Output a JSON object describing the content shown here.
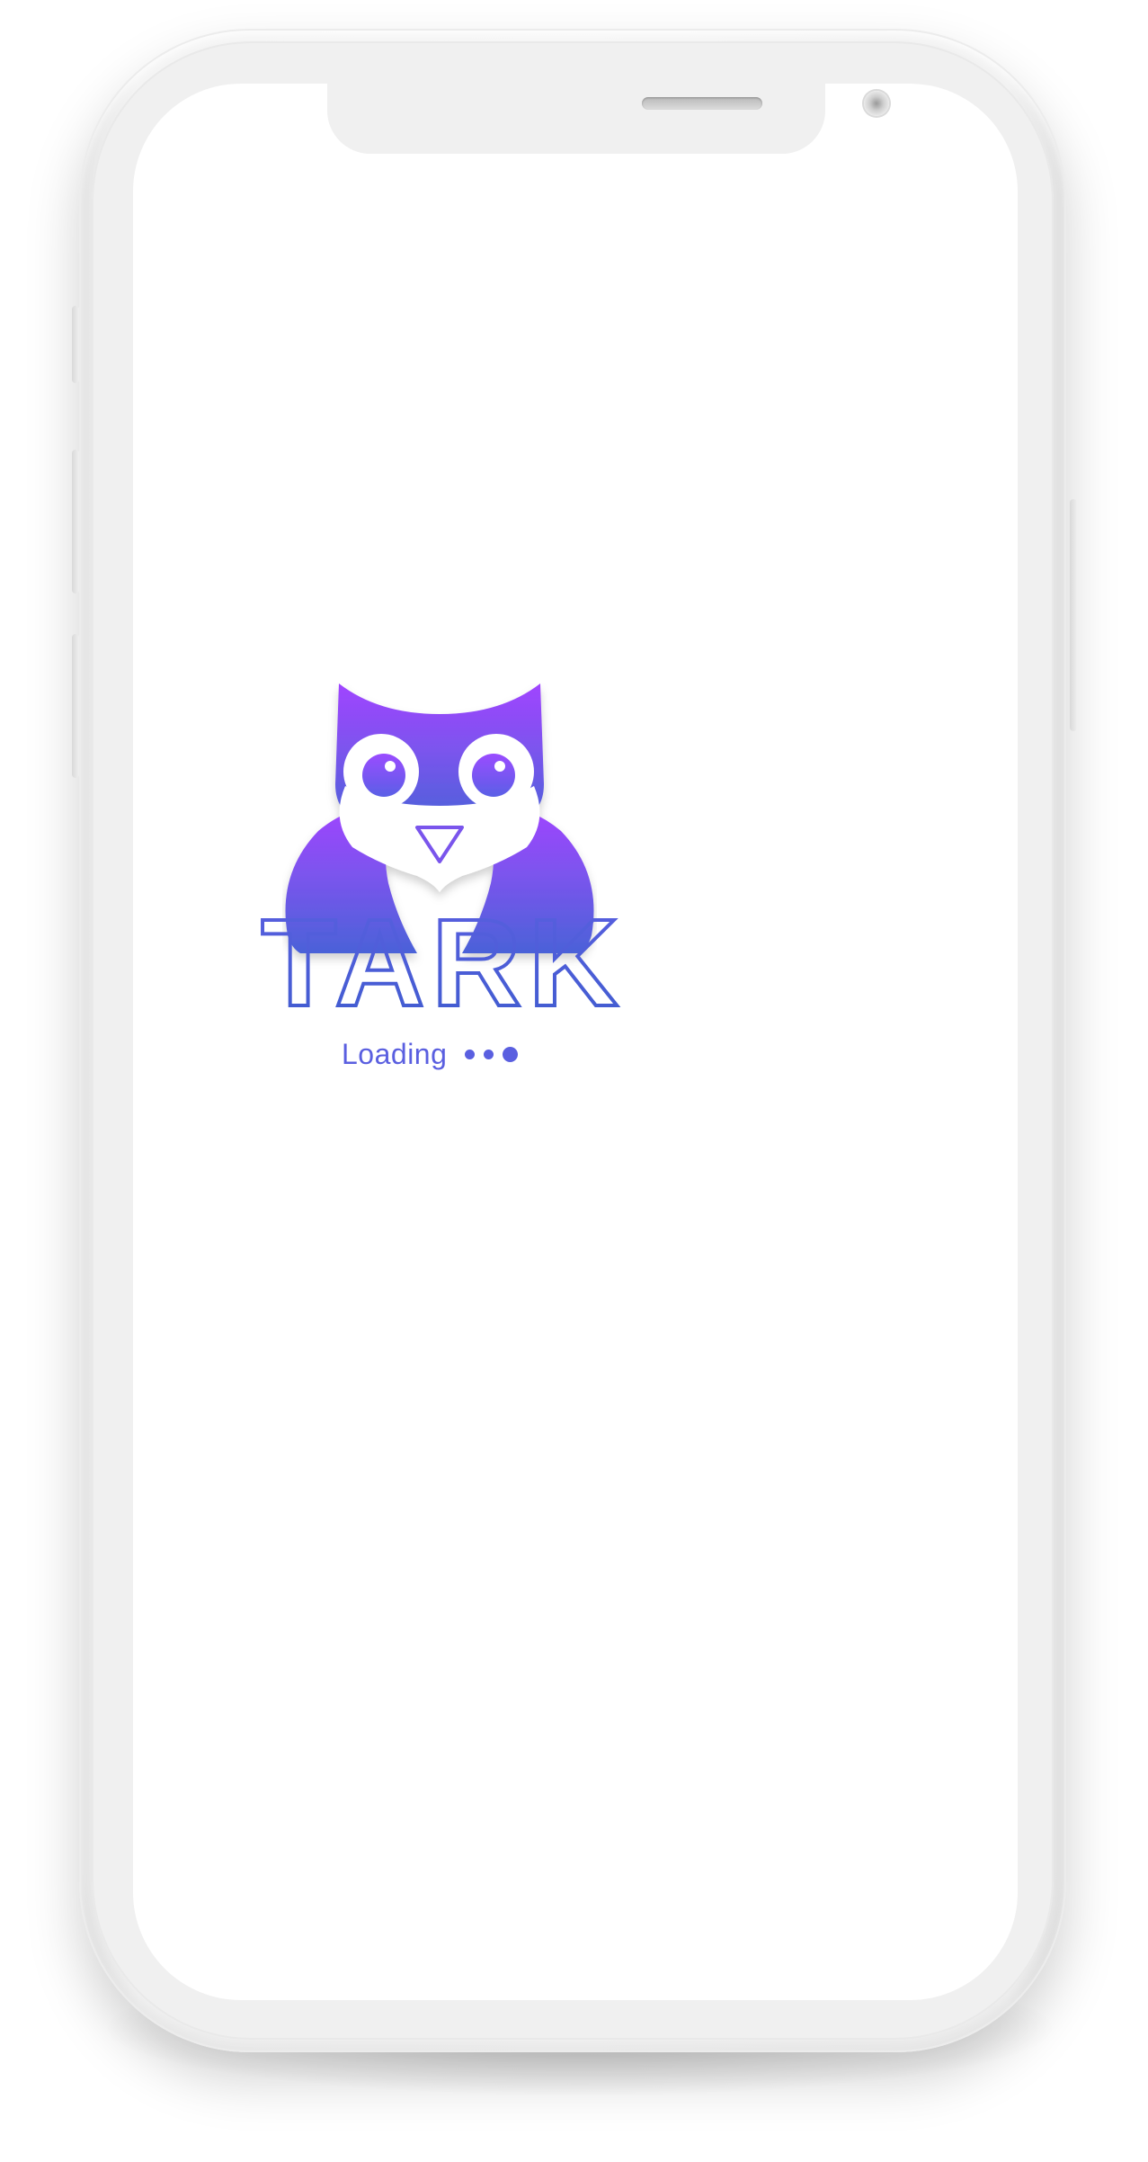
{
  "app": {
    "name": "TARK",
    "status_text": "Loading"
  },
  "colors": {
    "brand_purple": "#a044ff",
    "brand_blue": "#4a62d8",
    "loading_text": "#5a5fe0",
    "screen_background": "#ffffff",
    "device_body": "#f4f4f4"
  },
  "icons": {
    "logo": "owl-logo-icon",
    "loading_indicator": "loading-dots-icon"
  }
}
